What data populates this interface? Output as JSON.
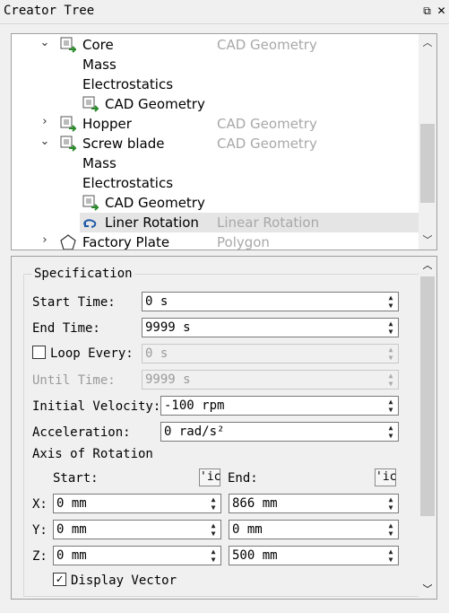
{
  "window": {
    "title": "Creator Tree"
  },
  "tree": {
    "items": [
      {
        "label": "Core",
        "type": "CAD Geometry"
      },
      {
        "label": "Mass"
      },
      {
        "label": "Electrostatics"
      },
      {
        "label": "CAD Geometry"
      },
      {
        "label": "Hopper",
        "type": "CAD Geometry"
      },
      {
        "label": "Screw blade",
        "type": "CAD Geometry"
      },
      {
        "label": "Mass"
      },
      {
        "label": "Electrostatics"
      },
      {
        "label": "CAD Geometry"
      },
      {
        "label": "Liner Rotation",
        "type": "Linear Rotation"
      },
      {
        "label": "Factory Plate",
        "type": "Polygon"
      }
    ]
  },
  "spec": {
    "title": "Specification",
    "start_time": {
      "label": "Start Time:",
      "value": "0 s"
    },
    "end_time": {
      "label": "End Time:",
      "value": "9999 s"
    },
    "loop_every": {
      "label": "Loop Every:",
      "value": "0 s",
      "checked": false
    },
    "until_time": {
      "label": "Until Time:",
      "value": "9999 s"
    },
    "initial_velocity": {
      "label": "Initial Velocity:",
      "value": "-100 rpm"
    },
    "acceleration": {
      "label": "Acceleration:",
      "value": "0 rad/s²"
    },
    "axis": {
      "title": "Axis of Rotation",
      "start_label": "Start:",
      "end_label": "End:",
      "pick_label": "'ic",
      "x_label": "X:",
      "y_label": "Y:",
      "z_label": "Z:",
      "start": {
        "x": "0 mm",
        "y": "0 mm",
        "z": "0 mm"
      },
      "end": {
        "x": "866 mm",
        "y": "0 mm",
        "z": "500 mm"
      }
    },
    "display_vector": {
      "label": "Display Vector",
      "checked": true
    }
  }
}
